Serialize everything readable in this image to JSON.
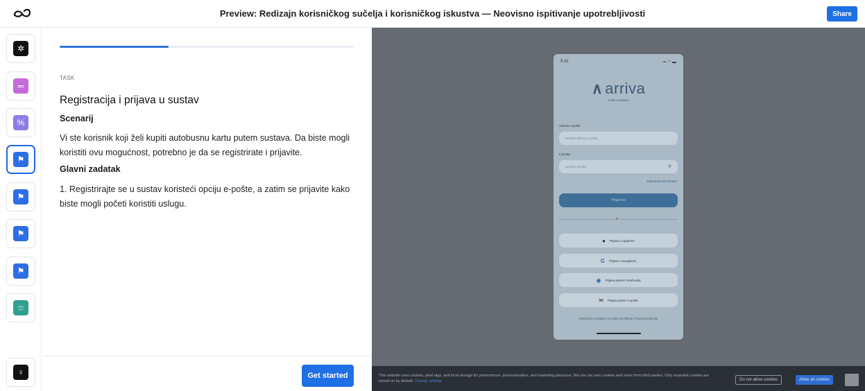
{
  "header": {
    "title": "Preview: Redizajn korisničkog sučelja i korisničkog iskustva — Neovisno ispitivanje upotrebljivosti",
    "share_label": "Share",
    "logo_icon": "infinity-logo-icon"
  },
  "sidebar": {
    "items": [
      {
        "icon": "gear-icon",
        "color": "#111111"
      },
      {
        "icon": "text-lines-icon",
        "color": "#c56bd9"
      },
      {
        "icon": "percent-icon",
        "color": "#8d7ee6"
      },
      {
        "icon": "flag-icon",
        "color": "#2d6ee5",
        "active": true
      },
      {
        "icon": "flag-icon",
        "color": "#2d6ee5"
      },
      {
        "icon": "flag-icon",
        "color": "#2d6ee5"
      },
      {
        "icon": "flag-icon",
        "color": "#2d6ee5"
      },
      {
        "icon": "star-icon",
        "color": "#2fa08f"
      }
    ],
    "bottom_icon": "lightbulb-icon"
  },
  "task": {
    "progress": 0.37,
    "label": "TASK",
    "title": "Registracija i prijava u sustav",
    "scenario_heading": "Scenarij",
    "scenario_text": "Vi ste korisnik koji želi kupiti autobusnu kartu putem sustava. Da biste mogli koristiti ovu mogućnost, potrebno je da se registrirate i prijavite.",
    "main_heading": "Glavni zadatak",
    "main_text": "1. Registrirajte se u sustav koristeći opciju e-pošte, a zatim se prijavite kako biste mogli početi koristiti uslugu.",
    "get_started_label": "Get started"
  },
  "phone": {
    "time": "9:41",
    "signal": "▪▪ ◠ ▬",
    "brand": "arriva",
    "brand_sub": "a DB company",
    "email_label": "Adresa e-pošte",
    "email_placeholder": "Unesite adresu e-pošte",
    "password_label": "Lozinka",
    "password_placeholder": "Unesite lozinku",
    "forgot": "Zaboravili ste lozinku?",
    "login": "Prijavi se",
    "or": "ili",
    "apple": "Prijava s Appleom",
    "google": "Prijava s Googleom",
    "facebook": "Prijava putem Facebooka",
    "email_login": "Prijava putem e-pošte",
    "terms": "Nastavkom pristajete na Uvjete korištenja i Pravila privatnosti"
  },
  "cookies": {
    "text": "This website uses cookies, pixel tags, and local storage for performance, personalization, and marketing purposes. We use our own cookies and some from third parties. Only essential cookies are turned on by default.",
    "link": "Change settings",
    "deny_label": "Do not allow cookies",
    "allow_label": "Allow all cookies"
  }
}
